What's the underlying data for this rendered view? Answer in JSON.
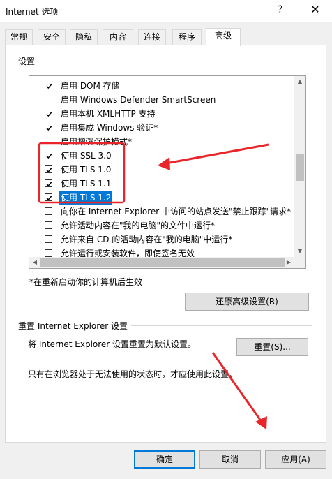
{
  "window": {
    "title": "Internet 选项",
    "help_glyph": "?",
    "close_glyph": "✕"
  },
  "tabs": [
    "常规",
    "安全",
    "隐私",
    "内容",
    "连接",
    "程序",
    "高级"
  ],
  "settings": {
    "group_label": "设置",
    "items": [
      {
        "label": "启用 DOM 存储",
        "checked": true
      },
      {
        "label": "启用 Windows Defender SmartScreen",
        "checked": false
      },
      {
        "label": "启用本机 XMLHTTP 支持",
        "checked": true
      },
      {
        "label": "启用集成 Windows 验证*",
        "checked": true
      },
      {
        "label": "启用增强保护模式*",
        "checked": false
      },
      {
        "label": "使用 SSL 3.0",
        "checked": true
      },
      {
        "label": "使用 TLS 1.0",
        "checked": true
      },
      {
        "label": "使用 TLS 1.1",
        "checked": true
      },
      {
        "label": "使用 TLS 1.2",
        "checked": true,
        "selected": true
      },
      {
        "label": "向你在 Internet Explorer 中访问的站点发送\"禁止跟踪\"请求*",
        "checked": false
      },
      {
        "label": "允许活动内容在\"我的电脑\"的文件中运行*",
        "checked": false
      },
      {
        "label": "允许来自 CD 的活动内容在\"我的电脑\"中运行*",
        "checked": false
      },
      {
        "label": "允许运行或安装软件，即使签名无效",
        "checked": false
      }
    ],
    "restart_note": "*在重新启动你的计算机后生效",
    "restore_button": "还原高级设置(R)"
  },
  "reset": {
    "group_label": "重置 Internet Explorer 设置",
    "description": "将 Internet Explorer 设置重置为默认设置。",
    "button": "重置(S)...",
    "note": "只有在浏览器处于无法使用的状态时，才应使用此设置。"
  },
  "footer": {
    "ok": "确定",
    "cancel": "取消",
    "apply": "应用(A)"
  },
  "colors": {
    "annotation": "#e8262a",
    "selection": "#0078d7"
  }
}
